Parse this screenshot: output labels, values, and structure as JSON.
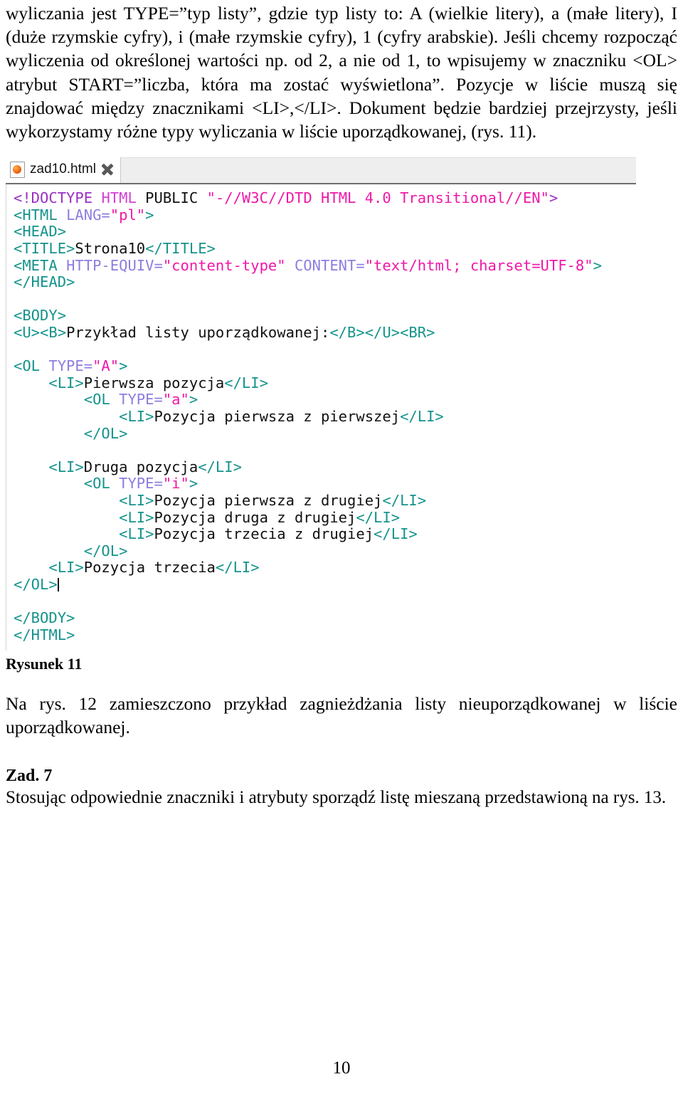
{
  "document": {
    "page_number": "10",
    "intro_paragraph": "wyliczania jest TYPE=”typ listy”, gdzie typ listy to: A (wielkie litery), a (małe litery), I (duże rzymskie cyfry), i (małe rzymskie cyfry), 1 (cyfry arabskie). Jeśli chcemy rozpocząć wyliczenia od określonej wartości np. od 2, a nie od 1, to wpisujemy w znaczniku <OL> atrybut START=”liczba, która ma zostać wyświetlona”. Pozycje w liście muszą się znajdować między znacznikami <LI>,</LI>. Dokument będzie bardziej przejrzysty, jeśli wykorzystamy różne typy wyliczania w liście uporządkowanej, (rys. 11).",
    "figure_caption": "Rysunek 11",
    "after_figure_paragraph": "Na rys. 12 zamieszczono przykład zagnieżdżania listy nieuporządkowanej w liście uporządkowanej.",
    "task_heading": "Zad. 7",
    "task_text": "Stosując odpowiednie znaczniki i atrybuty sporządź listę mieszaną przedstawioną na rys. 13."
  },
  "editor": {
    "tab": {
      "label": "zad10.html",
      "icon": "html-file-icon",
      "close_icon": "close-icon"
    },
    "code_lines": [
      {
        "tokens": [
          {
            "t": "<!DOCTYPE",
            "c": "doc"
          },
          {
            "t": " ",
            "c": "txt"
          },
          {
            "t": "HTML",
            "c": "docname"
          },
          {
            "t": " PUBLIC ",
            "c": "txt"
          },
          {
            "t": "\"-//W3C//DTD HTML 4.0 Transitional//EN\"",
            "c": "val"
          },
          {
            "t": ">",
            "c": "doc"
          }
        ]
      },
      {
        "tokens": [
          {
            "t": "<HTML ",
            "c": "tag"
          },
          {
            "t": "LANG=",
            "c": "attr"
          },
          {
            "t": "\"pl\"",
            "c": "val"
          },
          {
            "t": ">",
            "c": "tag"
          }
        ]
      },
      {
        "tokens": [
          {
            "t": "<HEAD>",
            "c": "tag"
          }
        ]
      },
      {
        "tokens": [
          {
            "t": "<TITLE>",
            "c": "tag"
          },
          {
            "t": "Strona10",
            "c": "txt"
          },
          {
            "t": "</TITLE>",
            "c": "tag"
          }
        ]
      },
      {
        "tokens": [
          {
            "t": "<META ",
            "c": "tag"
          },
          {
            "t": "HTTP-EQUIV=",
            "c": "attr"
          },
          {
            "t": "\"content-type\"",
            "c": "val"
          },
          {
            "t": " ",
            "c": "txt"
          },
          {
            "t": "CONTENT=",
            "c": "attr"
          },
          {
            "t": "\"text/html; charset=UTF-8\"",
            "c": "val"
          },
          {
            "t": ">",
            "c": "tag"
          }
        ]
      },
      {
        "tokens": [
          {
            "t": "</HEAD>",
            "c": "tag"
          }
        ]
      },
      {
        "tokens": [
          {
            "t": "",
            "c": "txt"
          }
        ]
      },
      {
        "tokens": [
          {
            "t": "<BODY>",
            "c": "tag"
          }
        ]
      },
      {
        "tokens": [
          {
            "t": "<U><B>",
            "c": "tag"
          },
          {
            "t": "Przykład listy uporządkowanej:",
            "c": "txt"
          },
          {
            "t": "</B></U><BR>",
            "c": "tag"
          }
        ]
      },
      {
        "tokens": [
          {
            "t": "",
            "c": "txt"
          }
        ]
      },
      {
        "tokens": [
          {
            "t": "<OL ",
            "c": "tag"
          },
          {
            "t": "TYPE=",
            "c": "attr"
          },
          {
            "t": "\"A\"",
            "c": "val"
          },
          {
            "t": ">",
            "c": "tag"
          }
        ]
      },
      {
        "tokens": [
          {
            "t": "    ",
            "c": "txt"
          },
          {
            "t": "<LI>",
            "c": "tag"
          },
          {
            "t": "Pierwsza pozycja",
            "c": "txt"
          },
          {
            "t": "</LI>",
            "c": "tag"
          }
        ]
      },
      {
        "tokens": [
          {
            "t": "        ",
            "c": "txt"
          },
          {
            "t": "<OL ",
            "c": "tag"
          },
          {
            "t": "TYPE=",
            "c": "attr"
          },
          {
            "t": "\"a\"",
            "c": "val"
          },
          {
            "t": ">",
            "c": "tag"
          }
        ]
      },
      {
        "tokens": [
          {
            "t": "            ",
            "c": "txt"
          },
          {
            "t": "<LI>",
            "c": "tag"
          },
          {
            "t": "Pozycja pierwsza z pierwszej",
            "c": "txt"
          },
          {
            "t": "</LI>",
            "c": "tag"
          }
        ]
      },
      {
        "tokens": [
          {
            "t": "        ",
            "c": "txt"
          },
          {
            "t": "</OL>",
            "c": "tag"
          }
        ]
      },
      {
        "tokens": [
          {
            "t": "",
            "c": "txt"
          }
        ]
      },
      {
        "tokens": [
          {
            "t": "    ",
            "c": "txt"
          },
          {
            "t": "<LI>",
            "c": "tag"
          },
          {
            "t": "Druga pozycja",
            "c": "txt"
          },
          {
            "t": "</LI>",
            "c": "tag"
          }
        ]
      },
      {
        "tokens": [
          {
            "t": "        ",
            "c": "txt"
          },
          {
            "t": "<OL ",
            "c": "tag"
          },
          {
            "t": "TYPE=",
            "c": "attr"
          },
          {
            "t": "\"i\"",
            "c": "val"
          },
          {
            "t": ">",
            "c": "tag"
          }
        ]
      },
      {
        "tokens": [
          {
            "t": "            ",
            "c": "txt"
          },
          {
            "t": "<LI>",
            "c": "tag"
          },
          {
            "t": "Pozycja pierwsza z drugiej",
            "c": "txt"
          },
          {
            "t": "</LI>",
            "c": "tag"
          }
        ]
      },
      {
        "tokens": [
          {
            "t": "            ",
            "c": "txt"
          },
          {
            "t": "<LI>",
            "c": "tag"
          },
          {
            "t": "Pozycja druga z drugiej",
            "c": "txt"
          },
          {
            "t": "</LI>",
            "c": "tag"
          }
        ]
      },
      {
        "tokens": [
          {
            "t": "            ",
            "c": "txt"
          },
          {
            "t": "<LI>",
            "c": "tag"
          },
          {
            "t": "Pozycja trzecia z drugiej",
            "c": "txt"
          },
          {
            "t": "</LI>",
            "c": "tag"
          }
        ]
      },
      {
        "tokens": [
          {
            "t": "        ",
            "c": "txt"
          },
          {
            "t": "</OL>",
            "c": "tag"
          }
        ]
      },
      {
        "tokens": [
          {
            "t": "    ",
            "c": "txt"
          },
          {
            "t": "<LI>",
            "c": "tag"
          },
          {
            "t": "Pozycja trzecia",
            "c": "txt"
          },
          {
            "t": "</LI>",
            "c": "tag"
          }
        ]
      },
      {
        "tokens": [
          {
            "t": "</OL>",
            "c": "tag"
          }
        ],
        "caret": true
      },
      {
        "tokens": [
          {
            "t": "",
            "c": "txt"
          }
        ]
      },
      {
        "tokens": [
          {
            "t": "</BODY>",
            "c": "tag"
          }
        ]
      },
      {
        "tokens": [
          {
            "t": "</HTML>",
            "c": "tag"
          }
        ]
      }
    ]
  }
}
